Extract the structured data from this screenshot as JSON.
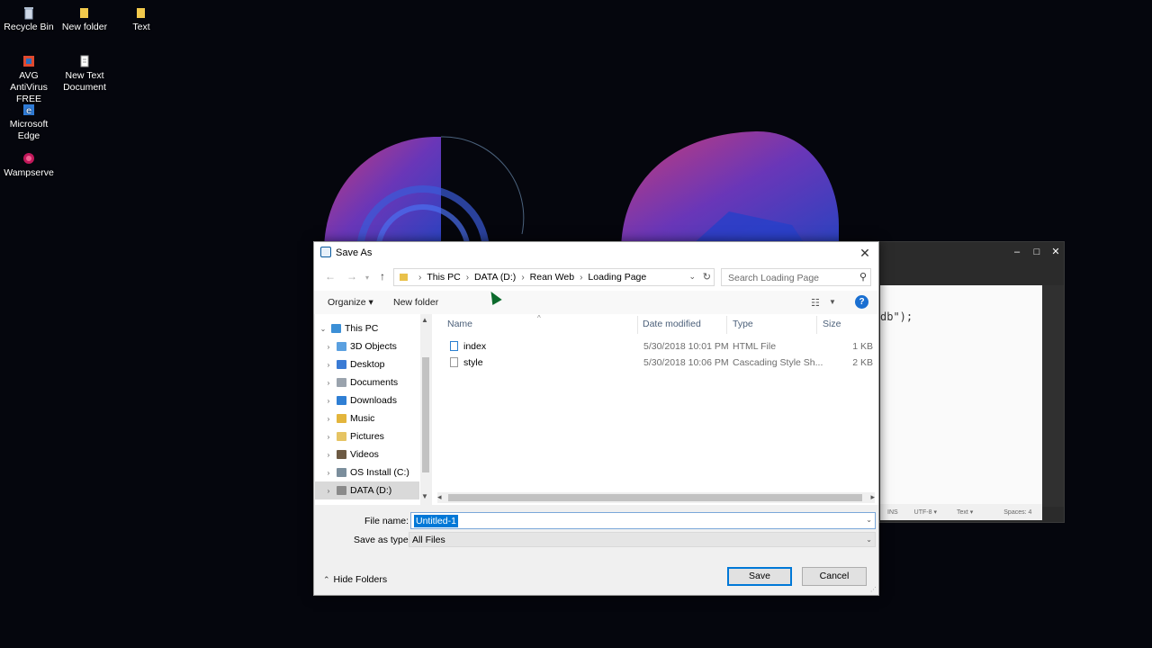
{
  "desktop": {
    "icons": [
      {
        "label": "Recycle Bin",
        "icon": "recycle-bin-icon"
      },
      {
        "label": "New folder",
        "icon": "folder-icon"
      },
      {
        "label": "Text",
        "icon": "folder-icon"
      },
      {
        "label": "AVG AntiVirus FREE",
        "icon": "avg-antivirus-icon"
      },
      {
        "label": "New Text Document",
        "icon": "text-document-icon"
      },
      {
        "label": "Microsoft Edge",
        "icon": "edge-icon"
      },
      {
        "label": "Wampserve",
        "icon": "wampserver-icon"
      }
    ]
  },
  "editor": {
    "code_fragment": "db\");",
    "status": {
      "ins": "INS",
      "encoding": "UTF-8 ▾",
      "syntax": "Text ▾",
      "spaces": "Spaces: 4"
    }
  },
  "dialog": {
    "title": "Save As",
    "breadcrumb": [
      "This PC",
      "DATA (D:)",
      "Rean Web",
      "Loading Page"
    ],
    "search_placeholder": "Search Loading Page",
    "toolbar": {
      "organize": "Organize ▾",
      "new_folder": "New folder"
    },
    "nav_tree": [
      {
        "label": "This PC",
        "icon_color": "#3b8fd6",
        "expanded": true
      },
      {
        "label": "3D Objects",
        "icon_color": "#5aa0e0"
      },
      {
        "label": "Desktop",
        "icon_color": "#3a7bd5"
      },
      {
        "label": "Documents",
        "icon_color": "#9aa3ad"
      },
      {
        "label": "Downloads",
        "icon_color": "#2f7fd4"
      },
      {
        "label": "Music",
        "icon_color": "#e3b53c"
      },
      {
        "label": "Pictures",
        "icon_color": "#e6c463"
      },
      {
        "label": "Videos",
        "icon_color": "#6d5a43"
      },
      {
        "label": "OS Install (C:)",
        "icon_color": "#7b8e9c"
      },
      {
        "label": "DATA (D:)",
        "icon_color": "#8a8a8a",
        "selected": true
      }
    ],
    "columns": [
      "Name",
      "Date modified",
      "Type",
      "Size"
    ],
    "files": [
      {
        "name": "index",
        "date": "5/30/2018 10:01 PM",
        "type": "HTML File",
        "size": "1 KB"
      },
      {
        "name": "style",
        "date": "5/30/2018 10:06 PM",
        "type": "Cascading Style Sh...",
        "size": "2 KB"
      }
    ],
    "file_name_label": "File name:",
    "file_name_value": "Untitled-1",
    "save_type_label": "Save as type:",
    "save_type_value": "All Files",
    "hide_folders": "Hide Folders",
    "save_button": "Save",
    "cancel_button": "Cancel",
    "accent_color": "#0078d7"
  }
}
